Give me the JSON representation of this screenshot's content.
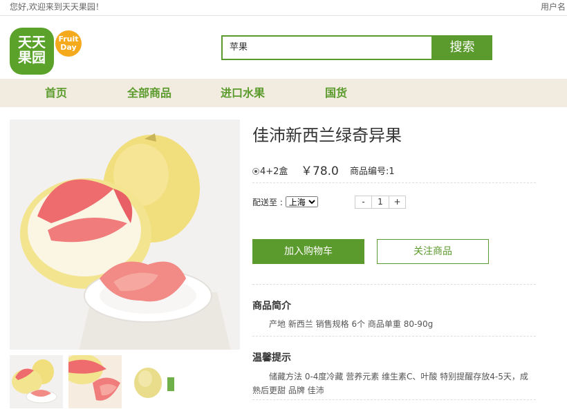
{
  "topbar": {
    "welcome": "您好,欢迎来到天天果园！",
    "user": "用户名"
  },
  "logo": {
    "line1": "天天",
    "line2": "果园",
    "fruit": "Fruit",
    "day": "Day"
  },
  "search": {
    "value": "苹果",
    "button": "搜索"
  },
  "nav": {
    "items": [
      "首页",
      "全部商品",
      "进口水果",
      "国货"
    ]
  },
  "product": {
    "title": "佳沛新西兰绿奇异果",
    "spec_option": "4+2盒",
    "price": "￥78.0",
    "code": "商品编号:1",
    "ship_label": "配送至 :",
    "ship_city": "上海",
    "qty_minus": "-",
    "qty_value": "1",
    "qty_plus": "+",
    "add_cart": "加入购物车",
    "follow": "关注商品"
  },
  "intro": {
    "title": "商品简介",
    "body": "产地 新西兰 销售规格 6个 商品单重 80-90g"
  },
  "tips": {
    "title": "温馨提示",
    "body": "储藏方法 0-4度冷藏 营养元素 维生素C、叶酸 特别提醒存放4-5天，成熟后更甜 品牌 佳沛"
  },
  "colors": {
    "accent": "#5b9a2c",
    "nav_bg": "#f2ece0",
    "logo_green": "#5aa22a",
    "logo_orange": "#f5a91d"
  }
}
